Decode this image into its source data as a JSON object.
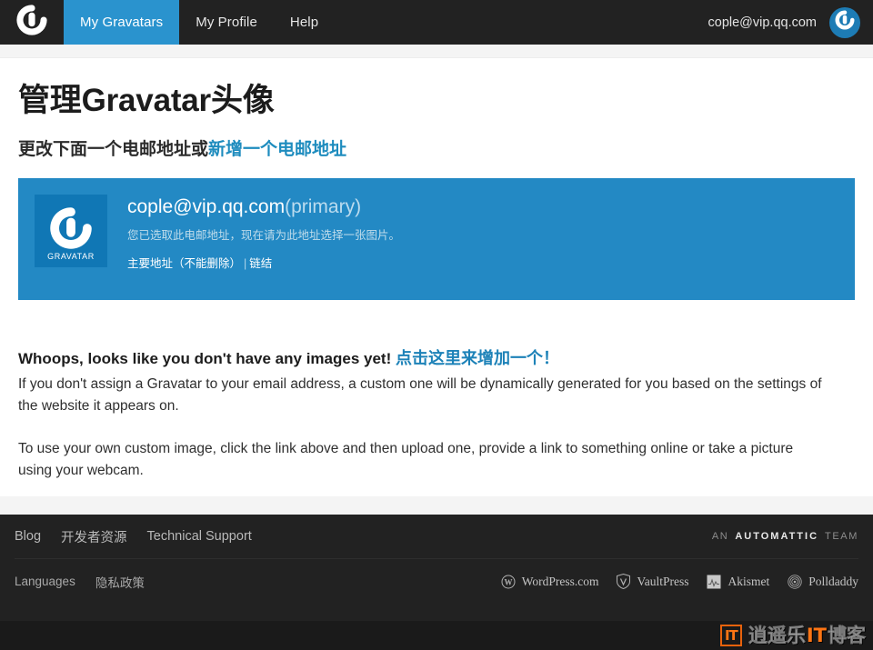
{
  "nav": {
    "logo_icon": "gravatar-spiral-icon",
    "items": [
      {
        "label": "My Gravatars",
        "active": true
      },
      {
        "label": "My Profile",
        "active": false
      },
      {
        "label": "Help",
        "active": false
      }
    ],
    "account_email": "cople@vip.qq.com",
    "avatar_icon": "gravatar-avatar-icon"
  },
  "main": {
    "title": "管理Gravatar头像",
    "subtitle_text": "更改下面一个电邮地址或",
    "subtitle_link": "新增一个电邮地址",
    "email_panel": {
      "tile_label": "GRAVATAR",
      "tile_icon": "gravatar-spiral-icon",
      "email": "cople@vip.qq.com",
      "primary_tag": "(primary)",
      "description": "您已选取此电邮地址，现在请为此地址选择一张图片。",
      "link_primary": "主要地址（不能删除）",
      "link_separator": "|",
      "link_rate": "链结"
    },
    "notice": {
      "headline": "Whoops, looks like you don't have any images yet!",
      "headline_link": "点击这里来增加一个！",
      "paragraph1": "If you don't assign a Gravatar to your email address, a custom one will be dynamically generated for you based on the settings of the website it appears on.",
      "paragraph2": "To use your own custom image, click the link above and then upload one, provide a link to something online or take a picture using your webcam."
    }
  },
  "footer": {
    "links_top": [
      "Blog",
      "开发者资源",
      "Technical Support"
    ],
    "links_bottom": [
      "Languages",
      "隐私政策"
    ],
    "automattic": {
      "prefix": "AN",
      "word": "AUTOMATTIC",
      "suffix": "TEAM"
    },
    "brands": [
      {
        "label": "WordPress.com",
        "icon": "wordpress-icon"
      },
      {
        "label": "VaultPress",
        "icon": "vaultpress-shield-icon"
      },
      {
        "label": "Akismet",
        "icon": "akismet-icon"
      },
      {
        "label": "Polldaddy",
        "icon": "polldaddy-icon"
      }
    ]
  },
  "watermark": {
    "badge": "IT",
    "text_part1": "逍遥乐",
    "text_part2": "IT",
    "text_part3": "博客"
  },
  "colors": {
    "nav_bg": "#222222",
    "accent": "#2a93ce",
    "panel_bg": "#2389c4",
    "tile_bg": "#1077b5",
    "link": "#1e8cbe",
    "watermark_orange": "#ff7514"
  }
}
